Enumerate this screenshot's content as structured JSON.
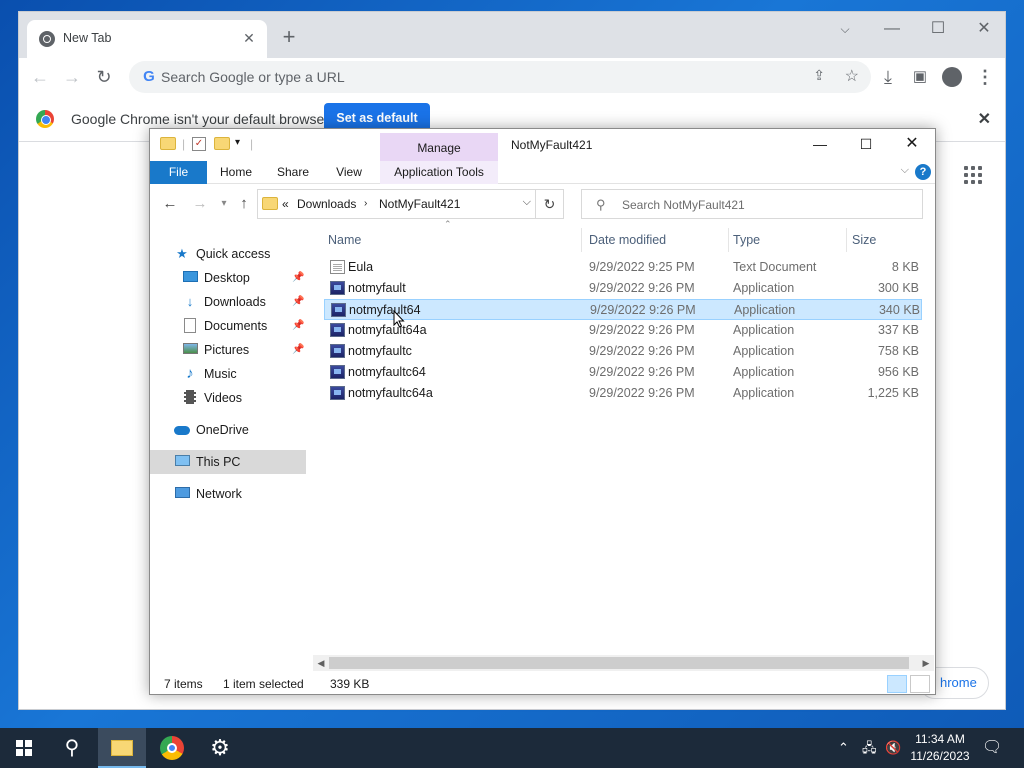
{
  "chrome": {
    "tab_title": "New Tab",
    "omnibox_placeholder": "Search Google or type a URL",
    "infobar_message": "Google Chrome isn't your default browser",
    "infobar_button": "Set as default",
    "customize_fragment": "hrome"
  },
  "explorer": {
    "window_title": "NotMyFault421",
    "ribbon": {
      "manage_label": "Manage",
      "tabs": [
        "File",
        "Home",
        "Share",
        "View",
        "Application Tools"
      ]
    },
    "address": {
      "overflow": "«",
      "crumbs": [
        "Downloads",
        "NotMyFault421"
      ]
    },
    "search_placeholder": "Search NotMyFault421",
    "nav": [
      {
        "label": "Quick access",
        "icon": "star-icon",
        "pinned": false
      },
      {
        "label": "Desktop",
        "icon": "desktop-icon",
        "pinned": true
      },
      {
        "label": "Downloads",
        "icon": "download-arrow-icon",
        "pinned": true
      },
      {
        "label": "Documents",
        "icon": "documents-icon",
        "pinned": true
      },
      {
        "label": "Pictures",
        "icon": "pictures-icon",
        "pinned": true
      },
      {
        "label": "Music",
        "icon": "music-note-icon",
        "pinned": false
      },
      {
        "label": "Videos",
        "icon": "film-icon",
        "pinned": false
      },
      {
        "label": "OneDrive",
        "icon": "cloud-icon",
        "pinned": false
      },
      {
        "label": "This PC",
        "icon": "computer-icon",
        "pinned": false,
        "selected": true
      },
      {
        "label": "Network",
        "icon": "network-icon",
        "pinned": false
      }
    ],
    "columns": [
      "Name",
      "Date modified",
      "Type",
      "Size"
    ],
    "files": [
      {
        "name": "Eula",
        "date": "9/29/2022 9:25 PM",
        "type": "Text Document",
        "size": "8 KB",
        "icon": "text-file-icon"
      },
      {
        "name": "notmyfault",
        "date": "9/29/2022 9:26 PM",
        "type": "Application",
        "size": "300 KB",
        "icon": "application-icon"
      },
      {
        "name": "notmyfault64",
        "date": "9/29/2022 9:26 PM",
        "type": "Application",
        "size": "340 KB",
        "icon": "application-icon",
        "selected": true
      },
      {
        "name": "notmyfault64a",
        "date": "9/29/2022 9:26 PM",
        "type": "Application",
        "size": "337 KB",
        "icon": "application-icon"
      },
      {
        "name": "notmyfaultc",
        "date": "9/29/2022 9:26 PM",
        "type": "Application",
        "size": "758 KB",
        "icon": "application-icon"
      },
      {
        "name": "notmyfaultc64",
        "date": "9/29/2022 9:26 PM",
        "type": "Application",
        "size": "956 KB",
        "icon": "application-icon"
      },
      {
        "name": "notmyfaultc64a",
        "date": "9/29/2022 9:26 PM",
        "type": "Application",
        "size": "1,225 KB",
        "icon": "application-icon"
      }
    ],
    "status": {
      "items": "7 items",
      "selected": "1 item selected",
      "size": "339 KB"
    }
  },
  "taskbar": {
    "time": "11:34 AM",
    "date": "11/26/2023"
  },
  "colors": {
    "explorer_accent": "#1979ca",
    "selection_bg": "#cce8ff",
    "manage_tab": "#e9d7f5",
    "chrome_button": "#1a73e8"
  }
}
